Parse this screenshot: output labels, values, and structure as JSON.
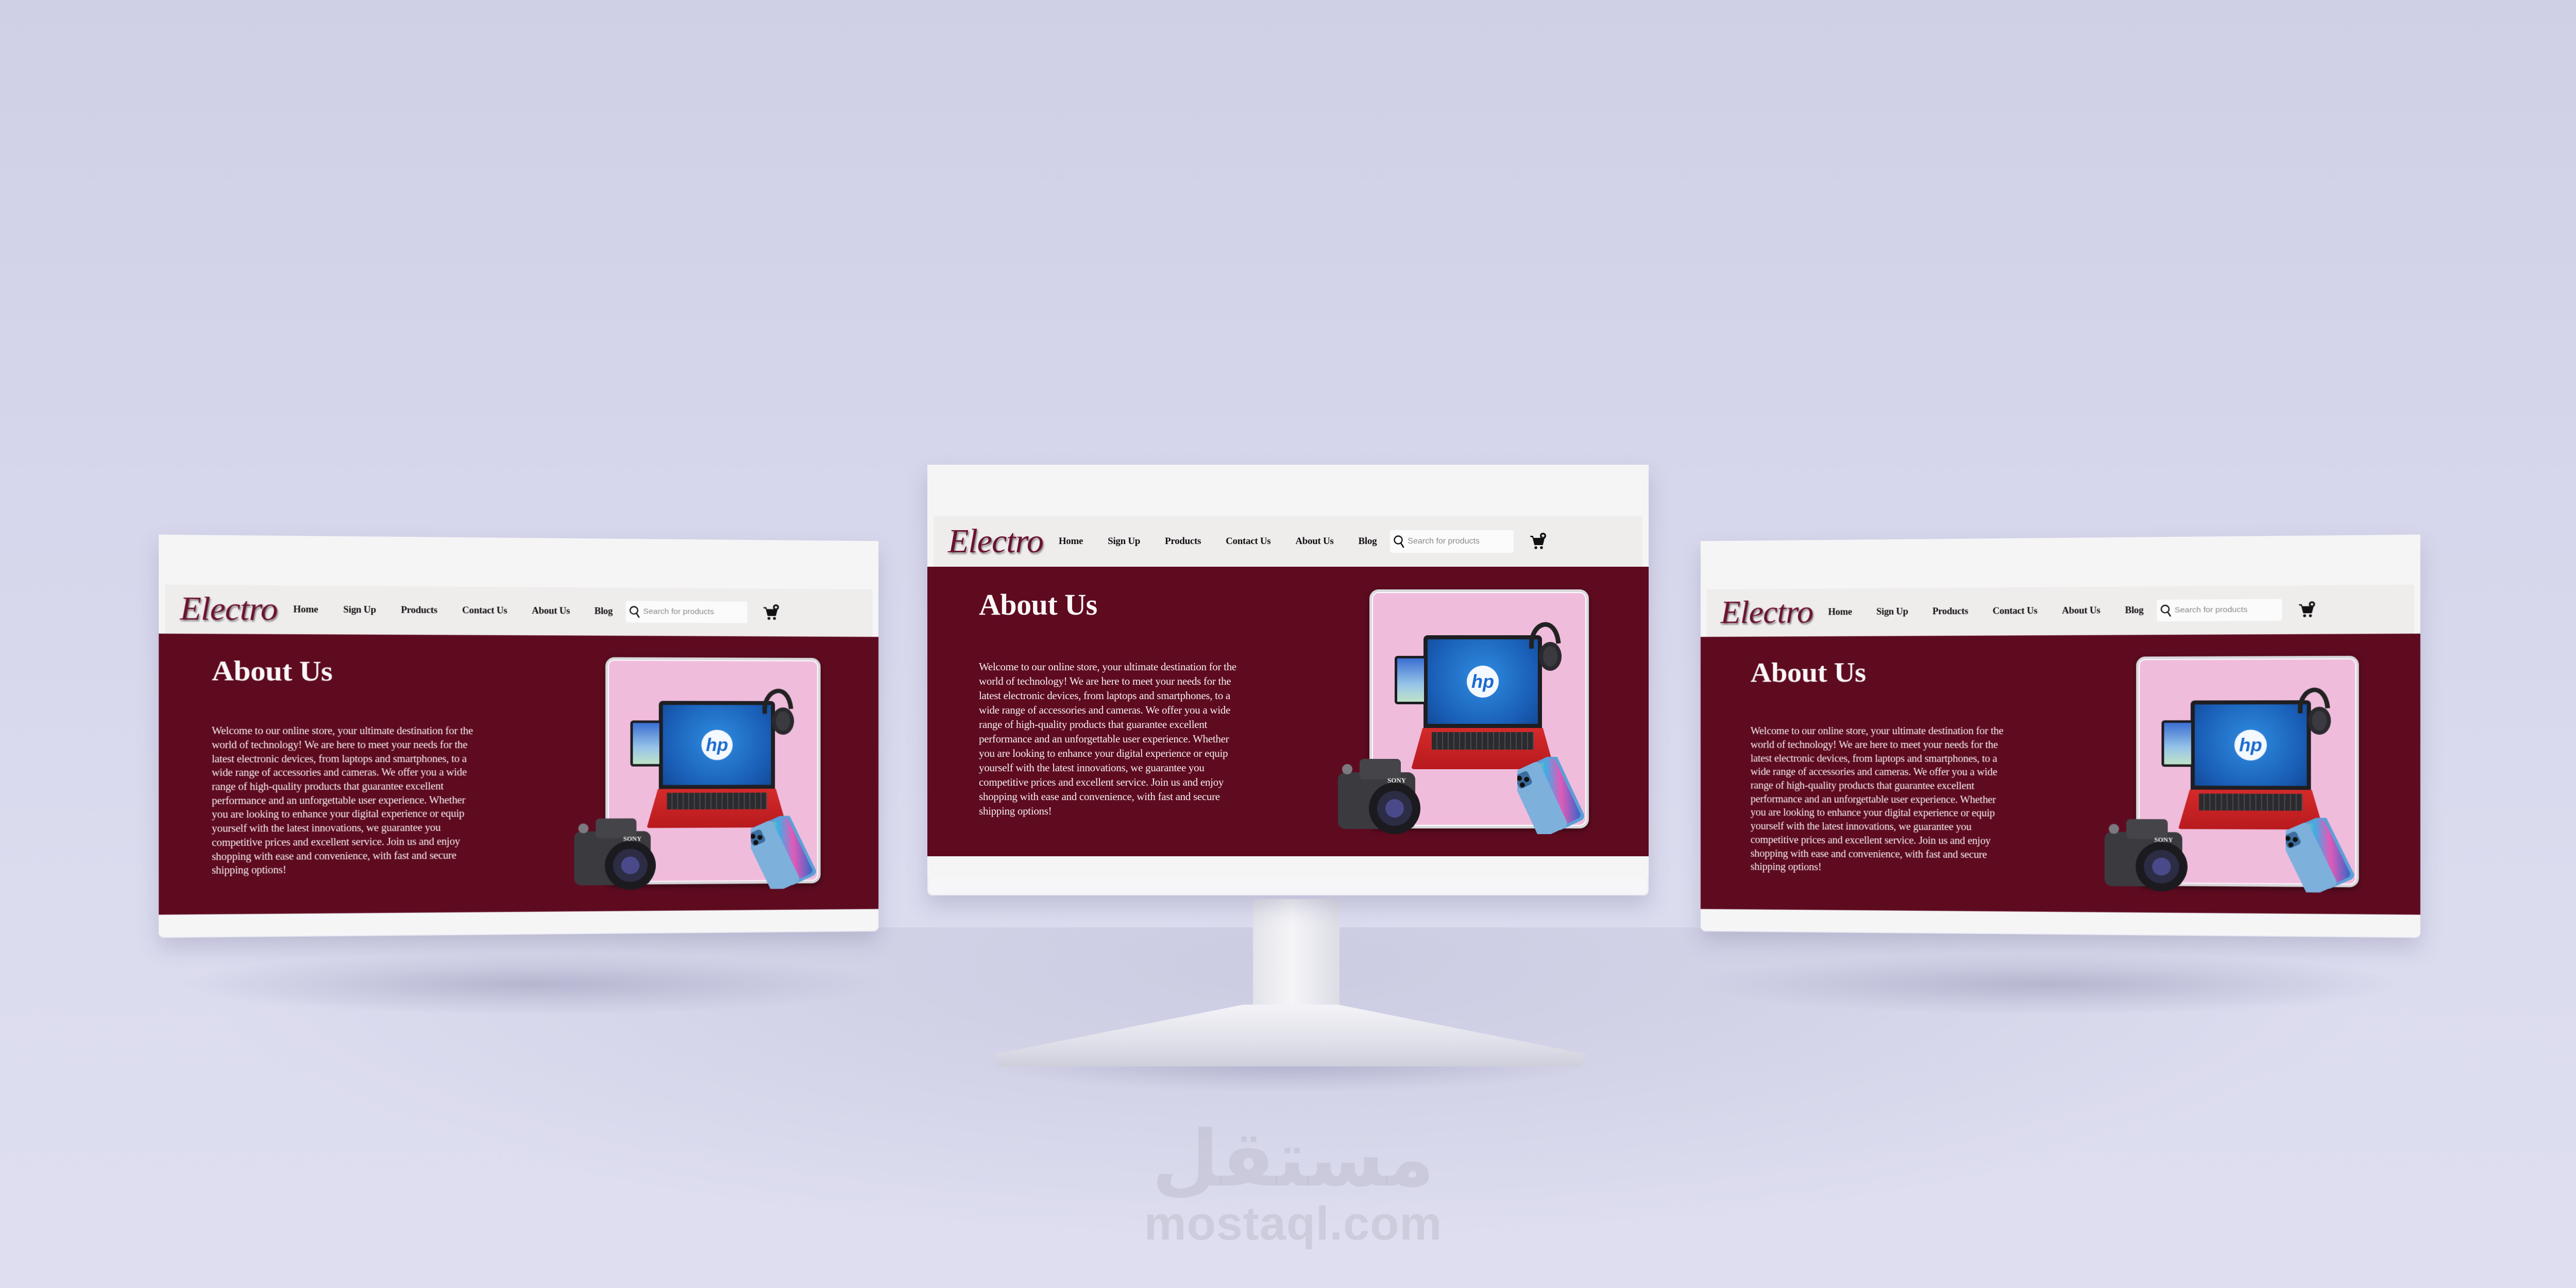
{
  "site": {
    "logo": "Electro",
    "nav": [
      "Home",
      "Sign Up",
      "Products",
      "Contact Us",
      "About Us",
      "Blog"
    ],
    "search": {
      "placeholder": "Search for products",
      "value": ""
    },
    "cart_icon": "cart-plus-icon",
    "hero": {
      "title": "About Us",
      "body": "Welcome to our online store, your ultimate destination for the world of technology! We are here to meet your needs for the latest electronic devices, from laptops and smartphones, to a wide range of accessories and cameras. We offer you a wide range of high-quality products that guarantee excellent performance and an unforgettable user experience. Whether you are looking to enhance your digital experience or equip yourself with the latest innovations, we guarantee you competitive prices and excellent service. Join us and enjoy shopping with ease and convenience, with fast and secure shipping options!",
      "image": {
        "laptop_brand": "hp",
        "camera_brand": "SONY",
        "items": [
          "laptop",
          "tablet",
          "headphones",
          "camera",
          "smartphone"
        ]
      }
    },
    "colors": {
      "brand": "#6b1230",
      "hero_bg": "#5e0b20",
      "header_bg": "#efecec",
      "card_bg": "#f0bcdc"
    }
  },
  "mockup": {
    "devices": [
      "left-display",
      "center-monitor",
      "right-display"
    ]
  },
  "watermark": {
    "arabic": "مستقل",
    "latin": "mostaql.com"
  }
}
